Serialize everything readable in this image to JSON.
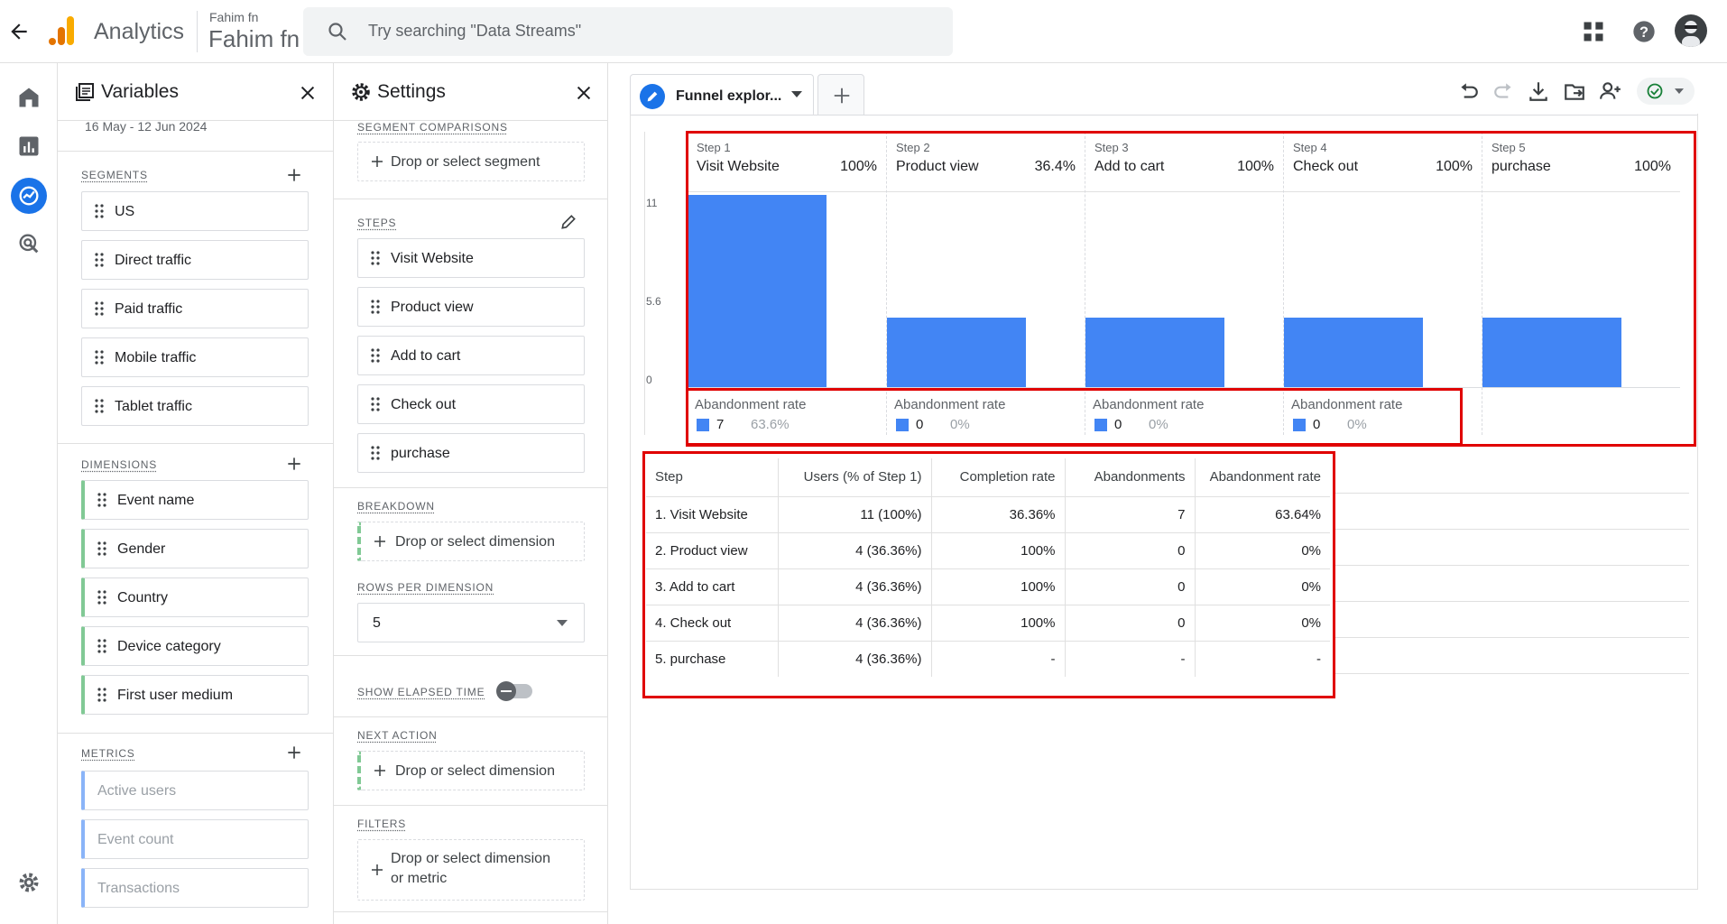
{
  "header": {
    "app_name": "Analytics",
    "account_small": "Fahim fn",
    "account_big": "Fahim fn",
    "search_placeholder": "Try searching \"Data Streams\""
  },
  "variables_panel": {
    "title": "Variables",
    "date_range": "16 May - 12 Jun 2024",
    "segments_label": "SEGMENTS",
    "segments": [
      "US",
      "Direct traffic",
      "Paid traffic",
      "Mobile traffic",
      "Tablet traffic"
    ],
    "dimensions_label": "DIMENSIONS",
    "dimensions": [
      "Event name",
      "Gender",
      "Country",
      "Device category",
      "First user medium"
    ],
    "metrics_label": "METRICS",
    "metrics": [
      "Active users",
      "Event count",
      "Transactions"
    ]
  },
  "settings_panel": {
    "title": "Settings",
    "segment_comparisons_label": "SEGMENT COMPARISONS",
    "drop_segment": "Drop or select segment",
    "steps_label": "STEPS",
    "steps": [
      "Visit Website",
      "Product view",
      "Add to cart",
      "Check out",
      "purchase"
    ],
    "breakdown_label": "BREAKDOWN",
    "drop_dimension": "Drop or select dimension",
    "rows_per_dimension_label": "ROWS PER DIMENSION",
    "rows_per_dimension_value": "5",
    "show_elapsed_time_label": "SHOW ELAPSED TIME",
    "next_action_label": "NEXT ACTION",
    "next_action_drop": "Drop or select dimension",
    "filters_label": "FILTERS",
    "filters_drop_line1": "Drop or select dimension",
    "filters_drop_line2": "or metric"
  },
  "tab": {
    "label": "Funnel explor..."
  },
  "chart_data": {
    "type": "bar",
    "y_ticks": [
      "11",
      "5.6",
      "0"
    ],
    "ylim": [
      0,
      11
    ],
    "steps": [
      {
        "num": "Step 1",
        "name": "Visit Website",
        "pct": "100%",
        "value": 11,
        "aband_title": "Abandonment rate",
        "aband_n": "7",
        "aband_p": "63.6%"
      },
      {
        "num": "Step 2",
        "name": "Product view",
        "pct": "36.4%",
        "value": 4,
        "aband_title": "Abandonment rate",
        "aband_n": "0",
        "aband_p": "0%"
      },
      {
        "num": "Step 3",
        "name": "Add to cart",
        "pct": "100%",
        "value": 4,
        "aband_title": "Abandonment rate",
        "aband_n": "0",
        "aband_p": "0%"
      },
      {
        "num": "Step 4",
        "name": "Check out",
        "pct": "100%",
        "value": 4,
        "aband_title": "Abandonment rate",
        "aband_n": "0",
        "aband_p": "0%"
      },
      {
        "num": "Step 5",
        "name": "purchase",
        "pct": "100%",
        "value": 4
      }
    ]
  },
  "table": {
    "headers": [
      "Step",
      "Users (% of Step 1)",
      "Completion rate",
      "Abandonments",
      "Abandonment rate"
    ],
    "rows": [
      [
        "1. Visit Website",
        "11 (100%)",
        "36.36%",
        "7",
        "63.64%"
      ],
      [
        "2. Product view",
        "4 (36.36%)",
        "100%",
        "0",
        "0%"
      ],
      [
        "3. Add to cart",
        "4 (36.36%)",
        "100%",
        "0",
        "0%"
      ],
      [
        "4. Check out",
        "4 (36.36%)",
        "100%",
        "0",
        "0%"
      ],
      [
        "5. purchase",
        "4 (36.36%)",
        "-",
        "-",
        "-"
      ]
    ]
  },
  "colors": {
    "bar": "#4285f4",
    "highlight": "#e00000",
    "accent": "#1a73e8"
  }
}
